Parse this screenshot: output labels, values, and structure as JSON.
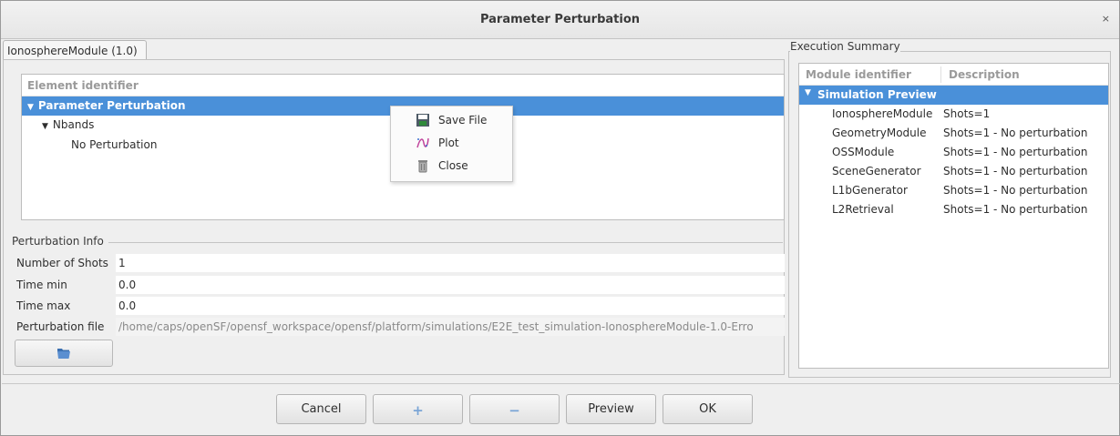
{
  "window": {
    "title": "Parameter Perturbation",
    "close_glyph": "×"
  },
  "tab": {
    "label": "IonosphereModule (1.0)"
  },
  "tree": {
    "header": "Element identifier",
    "rows": [
      {
        "label": "Parameter Perturbation",
        "expanded": true
      },
      {
        "label": "Nbands",
        "expanded": true
      },
      {
        "label": "No Perturbation"
      }
    ]
  },
  "context_menu": {
    "items": [
      {
        "label": "Save File",
        "icon": "save-icon"
      },
      {
        "label": "Plot",
        "icon": "plot-icon"
      },
      {
        "label": "Close",
        "icon": "trash-icon"
      }
    ]
  },
  "perturbation_info": {
    "group_label": "Perturbation Info",
    "number_of_shots_label": "Number of Shots",
    "number_of_shots_value": "1",
    "time_min_label": "Time min",
    "time_min_value": "0.0",
    "time_max_label": "Time max",
    "time_max_value": "0.0",
    "file_label": "Perturbation file",
    "file_value": "/home/caps/openSF/opensf_workspace/opensf/platform/simulations/E2E_test_simulation-IonosphereModule-1.0-Erro",
    "browse_icon": "folder-open-icon"
  },
  "execution_summary": {
    "group_label": "Execution Summary",
    "col_module": "Module identifier",
    "col_description": "Description",
    "root": "Simulation Preview",
    "rows": [
      {
        "module": "IonosphereModule",
        "description": "Shots=1"
      },
      {
        "module": "GeometryModule",
        "description": "Shots=1 - No perturbation"
      },
      {
        "module": "OSSModule",
        "description": "Shots=1 - No perturbation"
      },
      {
        "module": "SceneGenerator",
        "description": "Shots=1 - No perturbation"
      },
      {
        "module": "L1bGenerator",
        "description": "Shots=1 - No perturbation"
      },
      {
        "module": "L2Retrieval",
        "description": "Shots=1 - No perturbation"
      }
    ]
  },
  "buttons": {
    "cancel": "Cancel",
    "add": "+",
    "remove": "−",
    "preview": "Preview",
    "ok": "OK"
  },
  "colors": {
    "selection": "#4a90d9",
    "accent_icon": "#7aa5d6"
  }
}
